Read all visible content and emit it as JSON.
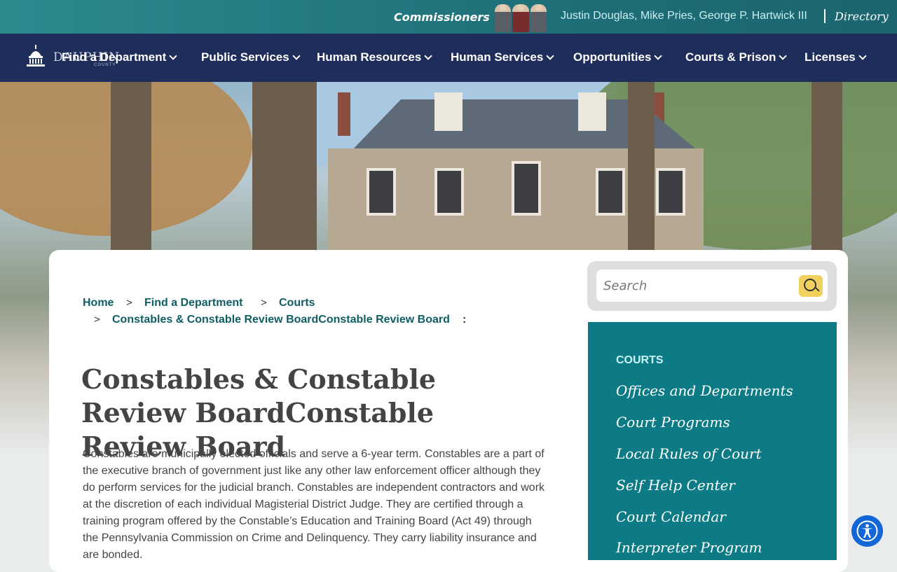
{
  "topbar": {
    "commissioners_label": "Commissioners",
    "commissioner_names": "Justin Douglas, Mike Pries, George P. Hartwick III",
    "directory_label": "Directory"
  },
  "logo": {
    "name": "DAUPHIN",
    "sub": "COUNTY"
  },
  "nav": {
    "items": [
      {
        "label": "Find a Department"
      },
      {
        "label": "Public Services"
      },
      {
        "label": "Human Resources"
      },
      {
        "label": "Human Services"
      },
      {
        "label": "Opportunities"
      },
      {
        "label": "Courts & Prison"
      },
      {
        "label": "Licenses"
      }
    ]
  },
  "breadcrumb": {
    "home": "Home",
    "department": "Find a Department",
    "courts": "Courts",
    "current": "Constables & Constable Review BoardConstable Review Board",
    "sep": ">",
    "trail_end": ":"
  },
  "page": {
    "title": "Constables & Constable Review BoardConstable Review Board",
    "body": "Constables are municipally elected officials and serve a 6-year term. Constables are a part of the executive branch of government just like any other law enforcement officer although they do perform services for the judicial branch.  Constables are independent contractors and work at the discretion of each individual Magisterial District Judge. They are certified through a training program offered by the Constable’s Education and Training Board (Act 49) through the Pennsylvania Commission on Crime and Delinquency.  They carry liability insurance and are bonded."
  },
  "search": {
    "placeholder": "Search"
  },
  "sidebar": {
    "heading": "COURTS",
    "links": [
      {
        "label": "Offices and Departments"
      },
      {
        "label": "Court Programs"
      },
      {
        "label": "Local Rules of Court"
      },
      {
        "label": "Self Help Center"
      },
      {
        "label": "Court Calendar"
      },
      {
        "label": "Interpreter Program"
      }
    ]
  },
  "colors": {
    "nav_bg": "#1e2d5a",
    "accent": "#0d7b85",
    "search_button": "#f1d15e",
    "a11y": "#1366d6"
  }
}
